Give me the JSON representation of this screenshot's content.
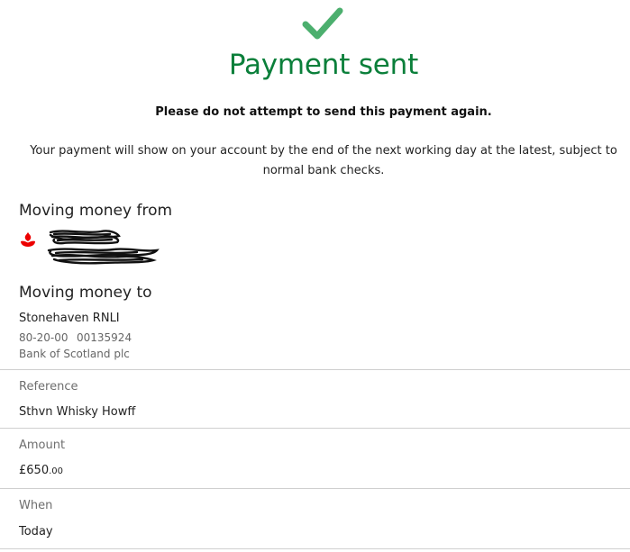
{
  "header": {
    "title": "Payment sent",
    "warning": "Please do not attempt to send this payment again.",
    "info": "Your payment will show on your account by the end of the next working day at the latest, subject to normal bank checks.",
    "status_icon": "checkmark-icon",
    "accent_color": "#0a7f3a",
    "check_color": "#4caf6e"
  },
  "from": {
    "heading": "Moving money from",
    "bank_icon": "santander-flame-icon",
    "bank_icon_color": "#ec0000"
  },
  "to": {
    "heading": "Moving money to",
    "name": "Stonehaven RNLI",
    "sort_code": "80-20-00",
    "account_number": "00135924",
    "bank": "Bank of Scotland plc"
  },
  "details": {
    "reference_label": "Reference",
    "reference_value": "Sthvn Whisky Howff",
    "amount_label": "Amount",
    "amount_pounds": "£650",
    "amount_pence": ".00",
    "when_label": "When",
    "when_value": "Today"
  }
}
